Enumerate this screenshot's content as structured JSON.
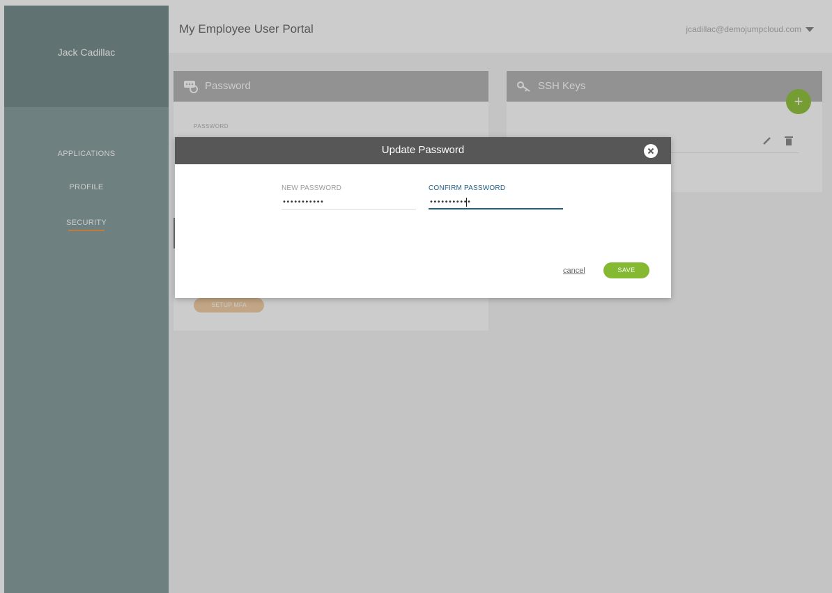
{
  "sidebar": {
    "user_name": "Jack Cadillac",
    "items": [
      {
        "label": "APPLICATIONS"
      },
      {
        "label": "PROFILE"
      },
      {
        "label": "SECURITY",
        "active": true
      }
    ],
    "active_underline_color": "#f29a4a"
  },
  "header": {
    "title": "My Employee User Portal",
    "user_email": "jcadillac@demojumpcloud.com"
  },
  "password_card": {
    "title": "Password",
    "field_label": "PASSWORD",
    "icon": "password-icon",
    "mfa_button": "SETUP MFA"
  },
  "ssh_card": {
    "title": "SSH Keys",
    "icon": "key-icon",
    "add_icon": "plus-icon",
    "row_icons": [
      "pencil-icon",
      "trash-icon"
    ]
  },
  "modal": {
    "title": "Update Password",
    "close_icon": "close-icon",
    "new_password": {
      "label": "NEW PASSWORD",
      "value": "•••••••••••"
    },
    "confirm_password": {
      "label": "CONFIRM PASSWORD",
      "value": "•••••••••••"
    },
    "cancel_label": "cancel",
    "save_label": "SAVE"
  },
  "colors": {
    "accent_green": "#84b931",
    "focus_blue": "#1d5f85",
    "modal_header": "#575757"
  }
}
